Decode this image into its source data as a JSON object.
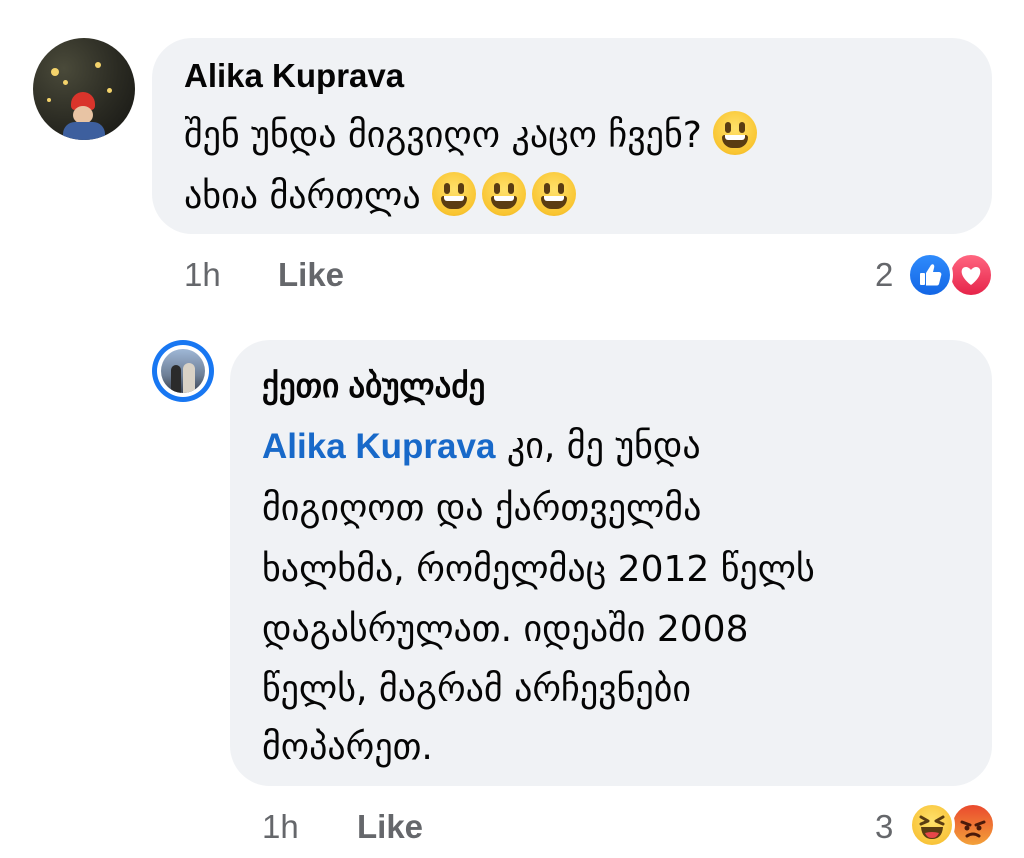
{
  "comment1": {
    "author": "Alika Kuprava",
    "lines": [
      "შენ უნდა მიგვიღო კაცო ჩვენ?",
      "ახია მართლა"
    ],
    "time": "1h",
    "like_label": "Like",
    "reaction_count": "2",
    "reactions": [
      "like-icon",
      "love-icon"
    ],
    "emojis": [
      "grinning-face",
      "grinning-face",
      "grinning-face",
      "grinning-face"
    ]
  },
  "reply1": {
    "author": "ქეთი აბულაძე",
    "mention": "Alika Kuprava",
    "lines": [
      "კი, მე უნდა",
      "მიგიღოთ და ქართველმა",
      "ხალხმა, რომელმაც 2012 წელს",
      "დაგასრულათ. იდეაში 2008",
      "წელს, მაგრამ არჩევნები",
      "მოპარეთ."
    ],
    "time": "1h",
    "like_label": "Like",
    "reaction_count": "3",
    "reactions": [
      "haha-icon",
      "angry-icon"
    ]
  },
  "colors": {
    "bubble": "#f0f2f5",
    "mention": "#1869c9",
    "meta": "#65676b",
    "avatar_ring": "#1877f2"
  }
}
